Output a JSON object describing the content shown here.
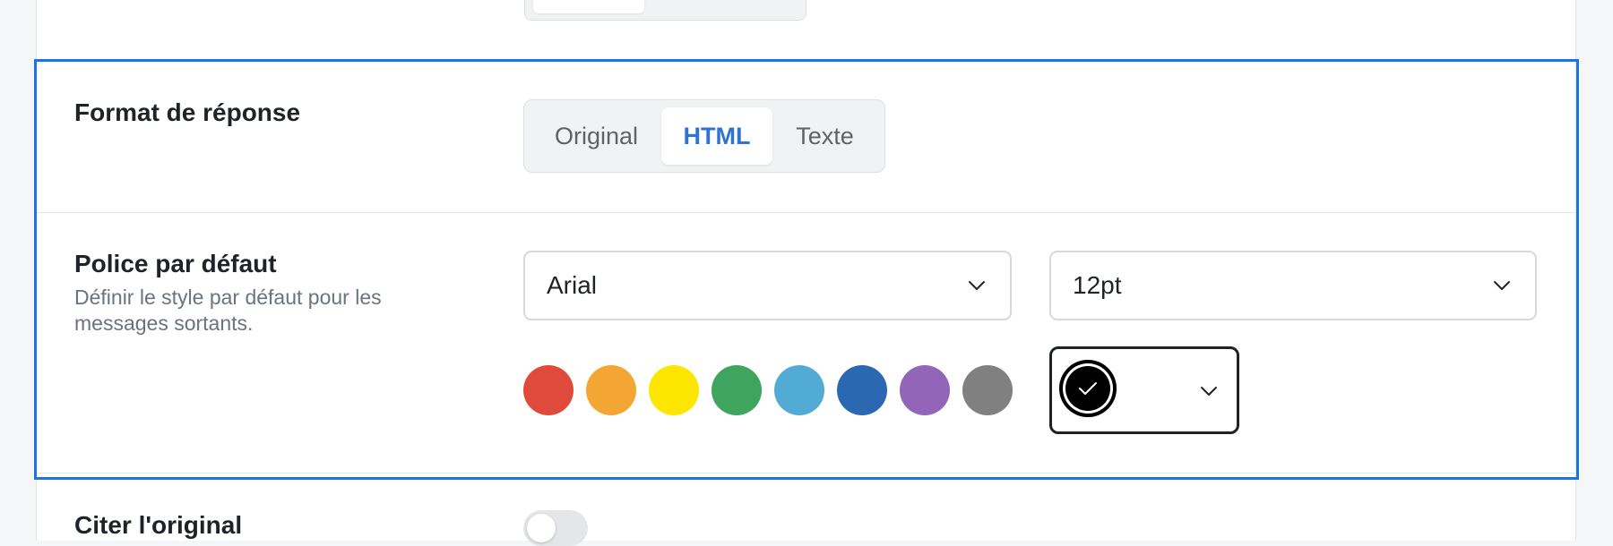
{
  "response_format": {
    "title": "Format de réponse",
    "options": [
      {
        "label": "Original",
        "active": false
      },
      {
        "label": "HTML",
        "active": true
      },
      {
        "label": "Texte",
        "active": false
      }
    ]
  },
  "default_font": {
    "title": "Police par défaut",
    "description": "Définir le style par défaut pour les messages sortants.",
    "font_family": "Arial",
    "font_size": "12pt",
    "chevron_icon": "chevron-down-icon",
    "swatches": [
      {
        "name": "red",
        "color": "#e04a3a"
      },
      {
        "name": "orange",
        "color": "#f3a634"
      },
      {
        "name": "yellow",
        "color": "#fde600"
      },
      {
        "name": "green",
        "color": "#3fa45e"
      },
      {
        "name": "light-blue",
        "color": "#52abd4"
      },
      {
        "name": "blue",
        "color": "#2a69b1"
      },
      {
        "name": "purple",
        "color": "#9265b9"
      },
      {
        "name": "gray",
        "color": "#808080"
      }
    ],
    "selected_color": "#000000",
    "selected_icon": "checkmark-icon"
  },
  "quote_original": {
    "title": "Citer l'original",
    "enabled": false
  },
  "accent_color": "#1a73e8"
}
